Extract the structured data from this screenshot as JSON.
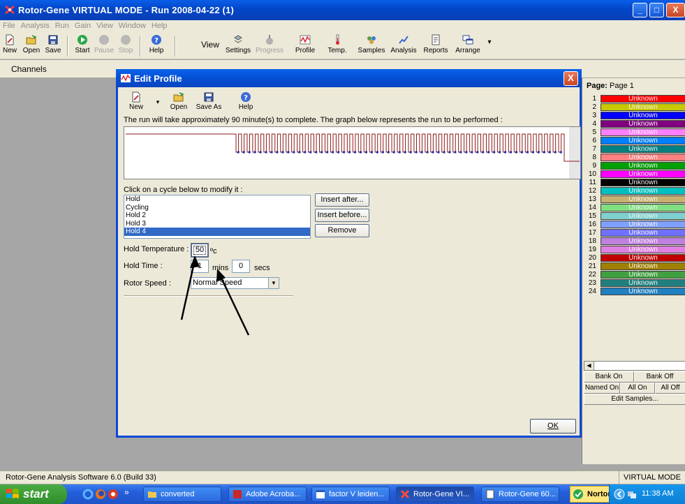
{
  "window": {
    "title": "Rotor-Gene VIRTUAL MODE - Run 2008-04-22 (1)",
    "controls": [
      "_",
      "□",
      "X"
    ]
  },
  "menu": [
    "File",
    "Analysis",
    "Run",
    "Gain",
    "View",
    "Window",
    "Help"
  ],
  "toolbar": {
    "new": "New",
    "open": "Open",
    "save": "Save",
    "start": "Start",
    "pause": "Pause",
    "stop": "Stop",
    "help": "Help",
    "view": "View",
    "settings": "Settings",
    "progress": "Progress",
    "profile": "Profile",
    "temp": "Temp.",
    "samples": "Samples",
    "analysis": "Analysis",
    "reports": "Reports",
    "arrange": "Arrange"
  },
  "channels_label": "Channels",
  "dialog": {
    "title": "Edit Profile",
    "close": "X",
    "toolbar": {
      "new": "New",
      "open": "Open",
      "save_as": "Save As",
      "help": "Help"
    },
    "info": "The run will take approximately 90 minute(s) to complete. The graph below represents the run to be performed :",
    "click_label": "Click on a cycle below to modify it :",
    "cycles": [
      "Hold",
      "Cycling",
      "Hold 2",
      "Hold 3",
      "Hold 4"
    ],
    "selected_cycle": 4,
    "buttons": {
      "insert_after": "Insert after...",
      "insert_before": "Insert before...",
      "remove": "Remove"
    },
    "hold_temperature_label": "Hold Temperature :",
    "hold_temperature": "50",
    "temp_unit": "ºc",
    "hold_time_label": "Hold Time :",
    "hold_mins": "1",
    "mins_label": "mins",
    "hold_secs": "0",
    "secs_label": "secs",
    "rotor_speed_label": "Rotor Speed :",
    "rotor_speed": "Normal Speed",
    "ok": "OK",
    "graph": {
      "colors": {
        "line": "#8b1a1a",
        "marker": "#1f2f9f"
      }
    }
  },
  "side_panel": {
    "page_label": "Page:",
    "page_value": "Page 1",
    "samples": [
      {
        "n": "1",
        "label": "Unknown",
        "color": "#ff0000"
      },
      {
        "n": "2",
        "label": "Unknown",
        "color": "#c8c800"
      },
      {
        "n": "3",
        "label": "Unknown",
        "color": "#0000ff"
      },
      {
        "n": "4",
        "label": "Unknown",
        "color": "#800080"
      },
      {
        "n": "5",
        "label": "Unknown",
        "color": "#ff80ff"
      },
      {
        "n": "6",
        "label": "Unknown",
        "color": "#0080ff"
      },
      {
        "n": "7",
        "label": "Unknown",
        "color": "#008080"
      },
      {
        "n": "8",
        "label": "Unknown",
        "color": "#ff8080"
      },
      {
        "n": "9",
        "label": "Unknown",
        "color": "#00a000"
      },
      {
        "n": "10",
        "label": "Unknown",
        "color": "#ff00ff"
      },
      {
        "n": "11",
        "label": "Unknown",
        "color": "#000000"
      },
      {
        "n": "12",
        "label": "Unknown",
        "color": "#00c0c0"
      },
      {
        "n": "13",
        "label": "Unknown",
        "color": "#c8b070"
      },
      {
        "n": "14",
        "label": "Unknown",
        "color": "#80e080"
      },
      {
        "n": "15",
        "label": "Unknown",
        "color": "#80d0d0"
      },
      {
        "n": "16",
        "label": "Unknown",
        "color": "#80a0ff"
      },
      {
        "n": "17",
        "label": "Unknown",
        "color": "#7070ff"
      },
      {
        "n": "18",
        "label": "Unknown",
        "color": "#c080e0"
      },
      {
        "n": "19",
        "label": "Unknown",
        "color": "#e080e0"
      },
      {
        "n": "20",
        "label": "Unknown",
        "color": "#c00000"
      },
      {
        "n": "21",
        "label": "Unknown",
        "color": "#a08000"
      },
      {
        "n": "22",
        "label": "Unknown",
        "color": "#40a040"
      },
      {
        "n": "23",
        "label": "Unknown",
        "color": "#208080"
      },
      {
        "n": "24",
        "label": "Unknown",
        "color": "#2080c0"
      }
    ],
    "bank_on": "Bank On",
    "bank_off": "Bank Off",
    "named_on": "Named On",
    "all_on": "All On",
    "all_off": "All Off",
    "edit_samples": "Edit Samples..."
  },
  "status": {
    "left": "Rotor-Gene Analysis Software 6.0 (Build 33)",
    "right": "VIRTUAL MODE"
  },
  "taskbar": {
    "start": "start",
    "quicklaunch_more": "»",
    "tasks": [
      "converted",
      "Adobe Acroba...",
      "factor V leiden...",
      "Rotor-Gene VI...",
      "Rotor-Gene 60..."
    ],
    "norton": "Norton",
    "clock": "11:38 AM"
  }
}
